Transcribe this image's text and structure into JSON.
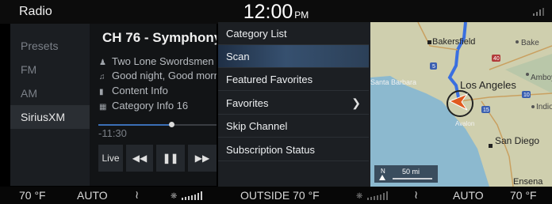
{
  "status": {
    "title": "Radio",
    "time": "12:00",
    "ampm": "PM",
    "signal_icon": "signal-icon"
  },
  "nav": {
    "items": [
      {
        "label": "Presets",
        "active": false
      },
      {
        "label": "FM",
        "active": false
      },
      {
        "label": "AM",
        "active": false
      },
      {
        "label": "SiriusXM",
        "active": true
      }
    ]
  },
  "now_playing": {
    "channel": "CH 76 - Symphony",
    "artist": "Two Lone Swordsmen",
    "song": "Good night, Good morning",
    "content": "Content Info",
    "category": "Category Info 16",
    "time_remaining": "-11:30",
    "progress": 0.62
  },
  "controls": {
    "live": "Live",
    "rewind_icon": "rewind-icon",
    "pause_icon": "pause-icon",
    "forward_icon": "fast-forward-icon"
  },
  "menu": {
    "items": [
      {
        "label": "Category List"
      },
      {
        "label": "Scan"
      },
      {
        "label": "Featured Favorites"
      },
      {
        "label": "Favorites"
      },
      {
        "label": "Skip Channel"
      },
      {
        "label": "Subscription Status"
      }
    ]
  },
  "map": {
    "cities": [
      "Bakersfield",
      "Bake",
      "Santa Barbara",
      "Amboy",
      "Los Angeles",
      "Indio",
      "Avalon",
      "San Diego",
      "Ensena"
    ],
    "highways": [
      "40",
      "5",
      "15",
      "10"
    ],
    "scale": "50 mi",
    "compass": "N"
  },
  "climate": {
    "left_temp": "70 °F",
    "left_mode": "AUTO",
    "outside": "OUTSIDE  70 °F",
    "right_mode": "AUTO",
    "right_temp": "70 °F"
  }
}
